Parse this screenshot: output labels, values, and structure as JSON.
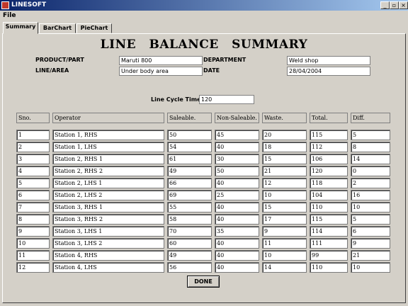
{
  "window": {
    "title": "LINESOFT",
    "min": "_",
    "max": "▫",
    "close": "×"
  },
  "menu": {
    "file": "File"
  },
  "tabs": [
    "Summary",
    "BarChart",
    "PieChart"
  ],
  "heading": "LINE BALANCE SUMMARY",
  "form": {
    "product_label": "PRODUCT/PART",
    "product": "Maruti 800",
    "department_label": "DEPARTMENT",
    "department": "Weld shop",
    "line_label": "LINE/AREA",
    "line": "Under body area",
    "date_label": "DATE",
    "date": "28/04/2004",
    "cycle_label": "Line Cycle Time",
    "cycle": "120"
  },
  "table": {
    "headers": [
      "Sno.",
      "Operator",
      "Saleable.",
      "Non-Saleable.",
      "Waste.",
      "Total.",
      "Diff."
    ],
    "rows": [
      [
        "1",
        "Station 1, RHS",
        "50",
        "45",
        "20",
        "115",
        "5"
      ],
      [
        "2",
        "Station 1, LHS",
        "54",
        "40",
        "18",
        "112",
        "8"
      ],
      [
        "3",
        "Station 2, RHS 1",
        "61",
        "30",
        "15",
        "106",
        "14"
      ],
      [
        "4",
        "Station 2, RHS 2",
        "49",
        "50",
        "21",
        "120",
        "0"
      ],
      [
        "5",
        "Station 2, LHS 1",
        "66",
        "40",
        "12",
        "118",
        "2"
      ],
      [
        "6",
        "Station 2, LHS 2",
        "69",
        "25",
        "10",
        "104",
        "16"
      ],
      [
        "7",
        "Station 3, RHS 1",
        "55",
        "40",
        "15",
        "110",
        "10"
      ],
      [
        "8",
        "Station 3, RHS 2",
        "58",
        "40",
        "17",
        "115",
        "5"
      ],
      [
        "9",
        "Station 3, LHS 1",
        "70",
        "35",
        "9",
        "114",
        "6"
      ],
      [
        "10",
        "Station 3, LHS 2",
        "60",
        "40",
        "11",
        "111",
        "9"
      ],
      [
        "11",
        "Station 4, RHS",
        "49",
        "40",
        "10",
        "99",
        "21"
      ],
      [
        "12",
        "Station 4, LHS",
        "56",
        "40",
        "14",
        "110",
        "10"
      ]
    ]
  },
  "done_label": "DONE"
}
